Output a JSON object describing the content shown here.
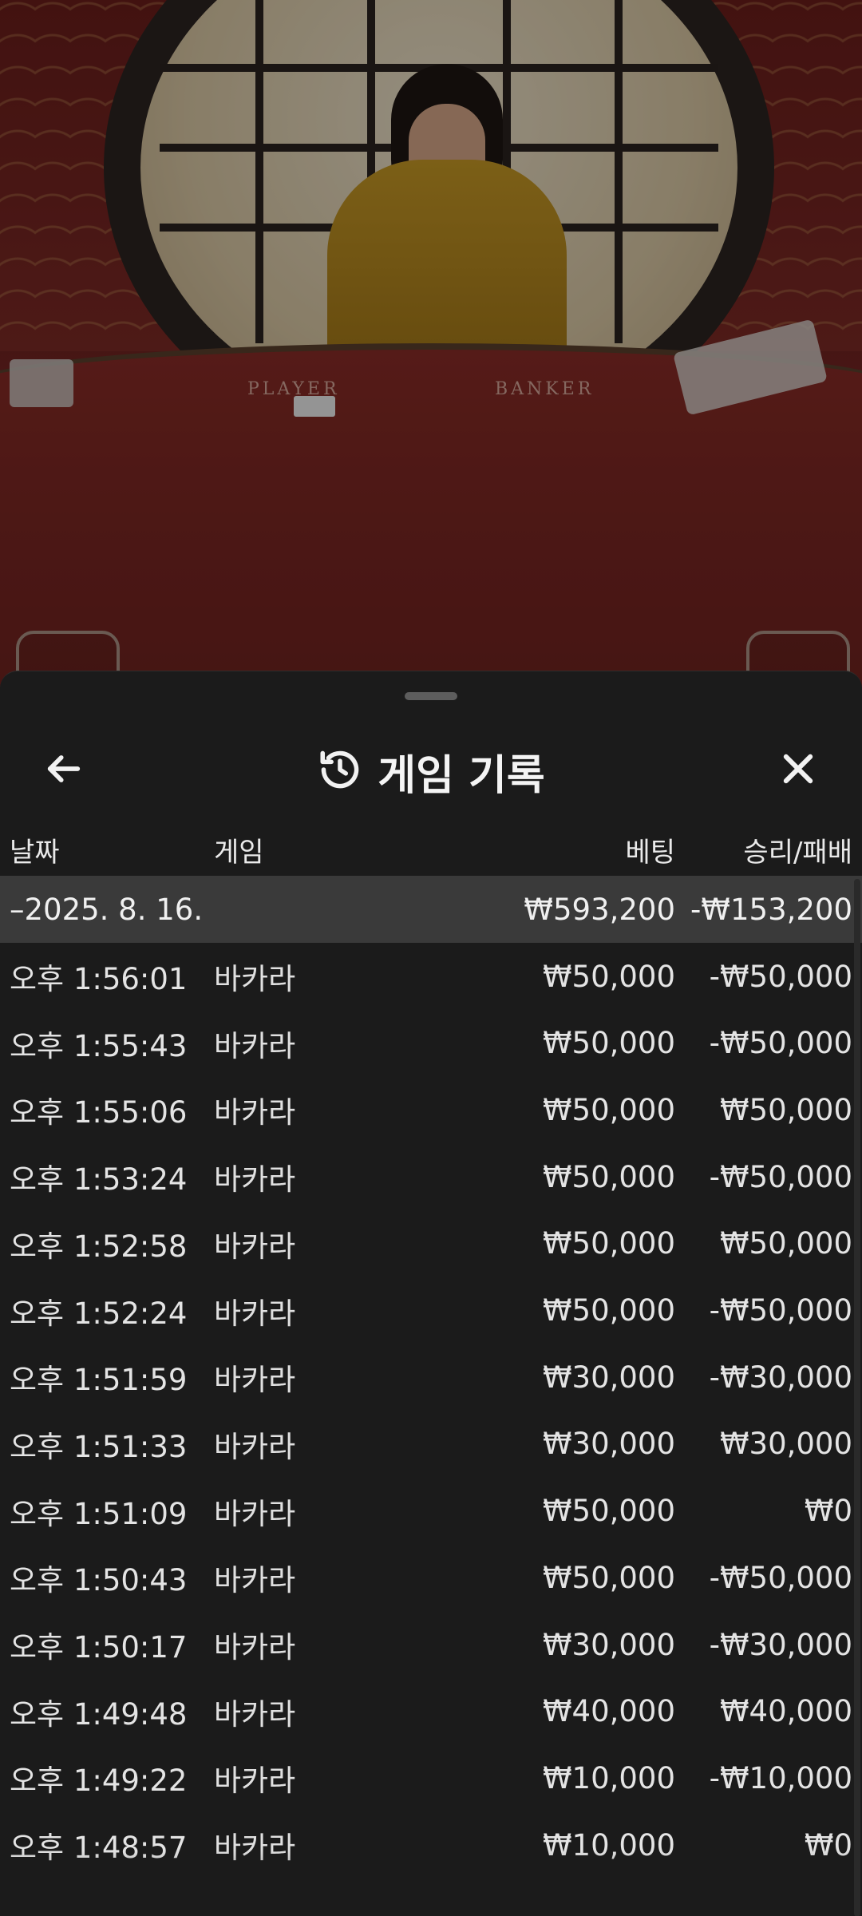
{
  "video": {
    "player_label": "PLAYER",
    "banker_label": "BANKER"
  },
  "sheet": {
    "title": "게임 기록",
    "icons": {
      "back": "arrow-left-icon",
      "history": "history-icon",
      "close": "close-icon"
    }
  },
  "columns": {
    "date": "날짜",
    "game": "게임",
    "bet": "베팅",
    "win_loss": "승리/패배"
  },
  "summary": {
    "date": "–2025. 8. 16.",
    "bet": "₩593,200",
    "win_loss": "-₩153,200"
  },
  "rows": [
    {
      "time": "오후 1:56:01",
      "game": "바카라",
      "bet": "₩50,000",
      "win_loss": "-₩50,000"
    },
    {
      "time": "오후 1:55:43",
      "game": "바카라",
      "bet": "₩50,000",
      "win_loss": "-₩50,000"
    },
    {
      "time": "오후 1:55:06",
      "game": "바카라",
      "bet": "₩50,000",
      "win_loss": "₩50,000"
    },
    {
      "time": "오후 1:53:24",
      "game": "바카라",
      "bet": "₩50,000",
      "win_loss": "-₩50,000"
    },
    {
      "time": "오후 1:52:58",
      "game": "바카라",
      "bet": "₩50,000",
      "win_loss": "₩50,000"
    },
    {
      "time": "오후 1:52:24",
      "game": "바카라",
      "bet": "₩50,000",
      "win_loss": "-₩50,000"
    },
    {
      "time": "오후 1:51:59",
      "game": "바카라",
      "bet": "₩30,000",
      "win_loss": "-₩30,000"
    },
    {
      "time": "오후 1:51:33",
      "game": "바카라",
      "bet": "₩30,000",
      "win_loss": "₩30,000"
    },
    {
      "time": "오후 1:51:09",
      "game": "바카라",
      "bet": "₩50,000",
      "win_loss": "₩0"
    },
    {
      "time": "오후 1:50:43",
      "game": "바카라",
      "bet": "₩50,000",
      "win_loss": "-₩50,000"
    },
    {
      "time": "오후 1:50:17",
      "game": "바카라",
      "bet": "₩30,000",
      "win_loss": "-₩30,000"
    },
    {
      "time": "오후 1:49:48",
      "game": "바카라",
      "bet": "₩40,000",
      "win_loss": "₩40,000"
    },
    {
      "time": "오후 1:49:22",
      "game": "바카라",
      "bet": "₩10,000",
      "win_loss": "-₩10,000"
    },
    {
      "time": "오후 1:48:57",
      "game": "바카라",
      "bet": "₩10,000",
      "win_loss": "₩0"
    }
  ]
}
